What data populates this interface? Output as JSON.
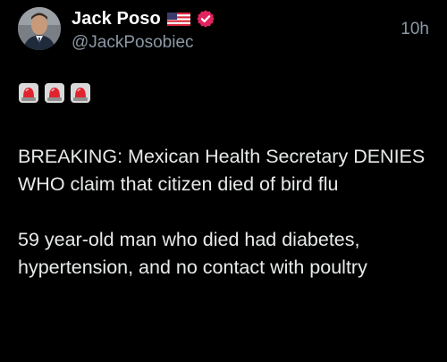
{
  "author": {
    "display_name": "Jack Poso",
    "handle": "@JackPosobiec",
    "flag_icon": "us-flag-icon",
    "badge_icon": "verified-badge-icon",
    "badge_color": "#e0245e"
  },
  "timestamp": "10h",
  "post": {
    "emoji": [
      "rotating-light-icon",
      "rotating-light-icon",
      "rotating-light-icon"
    ],
    "paragraphs": [
      "BREAKING: Mexican Health Secretary DENIES WHO claim that citizen died of bird flu",
      "59 year-old man who died had diabetes, hypertension, and no contact with poultry"
    ]
  },
  "colors": {
    "background": "#000000",
    "text": "#e7e9ea",
    "secondary_text": "#8b98a5"
  }
}
